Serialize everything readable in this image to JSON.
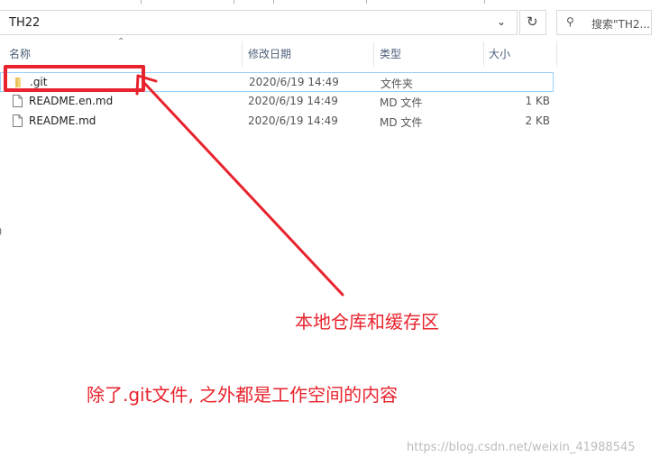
{
  "address_bar": {
    "path": "TH22"
  },
  "search": {
    "placeholder": "搜索\"TH2..."
  },
  "columns": {
    "name": "名称",
    "date": "修改日期",
    "type": "类型",
    "size": "大小"
  },
  "files": [
    {
      "name": ".git",
      "date": "2020/6/19 14:49",
      "type": "文件夹",
      "size": "",
      "icon": "folder-icon"
    },
    {
      "name": "README.en.md",
      "date": "2020/6/19 14:49",
      "type": "MD 文件",
      "size": "1 KB",
      "icon": "file-icon"
    },
    {
      "name": "README.md",
      "date": "2020/6/19 14:49",
      "type": "MD 文件",
      "size": "2 KB",
      "icon": "file-icon"
    }
  ],
  "annotations": {
    "arrow_label": "本地仓库和缓存区",
    "workspace_label": "除了.git文件, 之外都是工作空间的内容",
    "color": "#e8232d"
  },
  "watermark": "https://blog.csdn.net/weixin_41988545"
}
